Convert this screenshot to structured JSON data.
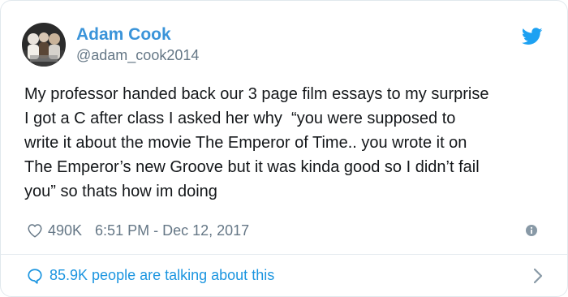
{
  "author": {
    "display_name": "Adam Cook",
    "handle": "@adam_cook2014"
  },
  "tweet": {
    "text": "My professor handed back our 3 page film essays to my surprise\nI got a C after class I asked her why  “you were supposed to\nwrite it about the movie The Emperor of Time.. you wrote it on\nThe Emperor’s new Groove but it was kinda good so I didn’t fail\nyou” so thats how im doing",
    "likes": "490K",
    "timestamp": "6:51 PM - Dec 12, 2017"
  },
  "footer": {
    "conversation_label": "85.9K people are talking about this"
  },
  "icons": {
    "brand": "twitter-bird-icon",
    "like": "heart-icon",
    "info": "info-icon",
    "reply": "speech-bubble-icon",
    "chevron": "chevron-right-icon"
  },
  "colors": {
    "name": "#3b94d9",
    "link": "#1b95e0",
    "muted": "#657786",
    "text": "#14171a",
    "bird": "#1da1f2"
  }
}
